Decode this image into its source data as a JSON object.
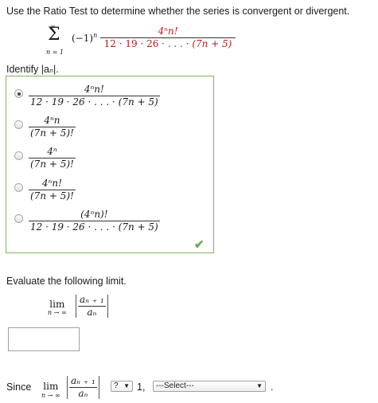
{
  "question": "Use the Ratio Test to determine whether the series is convergent or divergent.",
  "series": {
    "sigma": "Σ",
    "upper": "∞",
    "lower": "n = 1",
    "sign": "(−1)",
    "sign_exp": "n",
    "numerator": "4ⁿn!",
    "denominator_red": "12 · 19 · 26 · . . . ·",
    "denominator_end": "(7n + 5)"
  },
  "identify_label": "Identify  |aₙ|.",
  "options": [
    {
      "num": "4ⁿn!",
      "den": "12 · 19 · 26 · . . . · (7n + 5)",
      "checked": true
    },
    {
      "num": "4ⁿn",
      "den": "(7n + 5)!",
      "checked": false
    },
    {
      "num": "4ⁿ",
      "den": "(7n + 5)!",
      "checked": false
    },
    {
      "num": "4ⁿn!",
      "den": "(7n + 5)!",
      "checked": false
    },
    {
      "num": "(4ⁿn)!",
      "den": "12 · 19 · 26 · . . . · (7n + 5)",
      "checked": false
    }
  ],
  "correct_mark": "✔",
  "evaluate_label": "Evaluate the following limit.",
  "limit": {
    "lim": "lim",
    "sub": "n → ∞",
    "num": "aₙ ₊ ₁",
    "den": "aₙ"
  },
  "limit_input_value": "",
  "since": {
    "label": "Since",
    "compare_select": "?",
    "compare_value": "1,",
    "conclusion_select": "---Select---",
    "period": "."
  },
  "colors": {
    "accent_green": "#6aa84f",
    "red_text": "#b31b1b"
  }
}
